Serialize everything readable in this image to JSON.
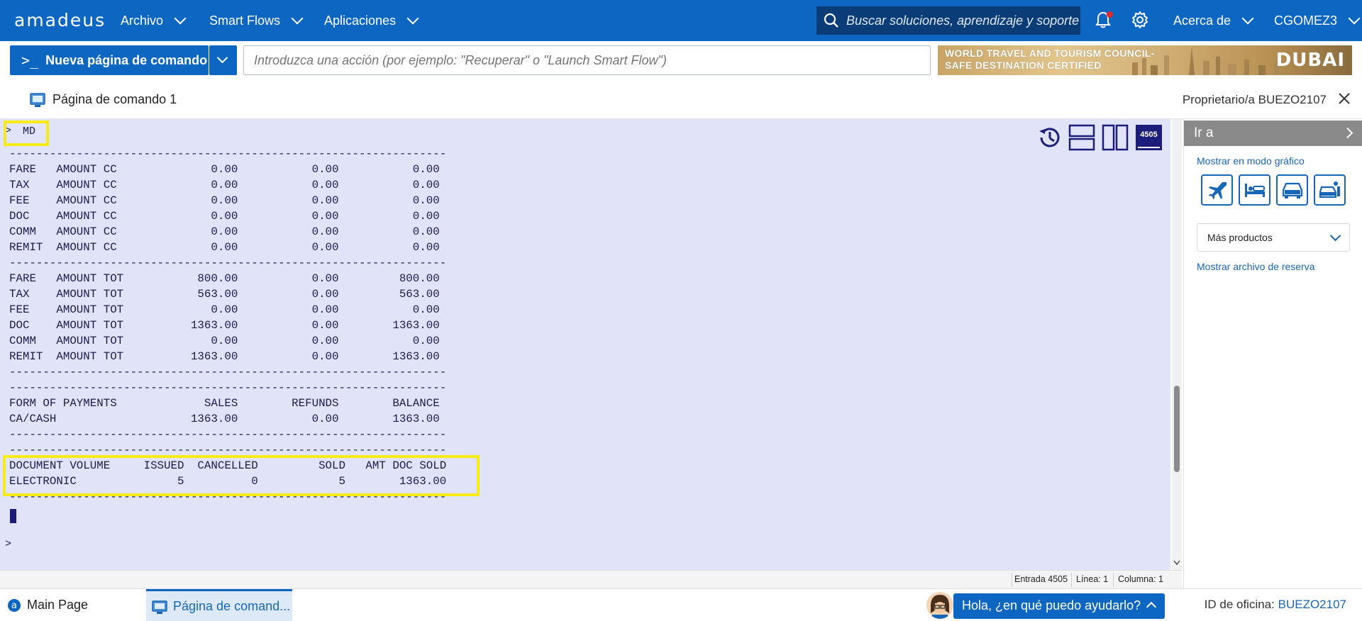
{
  "nav": {
    "logo": "amadeus",
    "menus": [
      {
        "label": "Archivo"
      },
      {
        "label": "Smart Flows"
      },
      {
        "label": "Aplicaciones"
      }
    ],
    "search_placeholder": "Buscar soluciones, aprendizaje y soporte",
    "about": "Acerca de",
    "user": "CGOMEZ3"
  },
  "commandbar": {
    "new_page_label": "Nueva página de comando",
    "action_placeholder": "Introduzca una acción (por ejemplo: \"Recuperar\" o \"Launch Smart Flow\")",
    "banner_line1": "WORLD TRAVEL AND TOURISM COUNCIL-",
    "banner_line2": "SAFE DESTINATION CERTIFIED",
    "banner_brand": "DUBAI"
  },
  "page": {
    "title": "Página de comando 1",
    "owner": "Proprietario/a BUEZO2107"
  },
  "terminal": {
    "prompt": ">",
    "command": "MD",
    "office_badge": "4505",
    "lines": [
      "",
      "-----------------------------------------------------------------",
      "FARE   AMOUNT CC              0.00           0.00           0.00",
      "TAX    AMOUNT CC              0.00           0.00           0.00",
      "FEE    AMOUNT CC              0.00           0.00           0.00",
      "DOC    AMOUNT CC              0.00           0.00           0.00",
      "COMM   AMOUNT CC              0.00           0.00           0.00",
      "REMIT  AMOUNT CC              0.00           0.00           0.00",
      "-----------------------------------------------------------------",
      "FARE   AMOUNT TOT           800.00           0.00         800.00",
      "TAX    AMOUNT TOT           563.00           0.00         563.00",
      "FEE    AMOUNT TOT             0.00           0.00           0.00",
      "DOC    AMOUNT TOT          1363.00           0.00        1363.00",
      "COMM   AMOUNT TOT             0.00           0.00           0.00",
      "REMIT  AMOUNT TOT          1363.00           0.00        1363.00",
      "-----------------------------------------------------------------",
      "-----------------------------------------------------------------",
      "FORM OF PAYMENTS             SALES        REFUNDS        BALANCE",
      "CA/CASH                    1363.00           0.00        1363.00",
      "-----------------------------------------------------------------",
      "-----------------------------------------------------------------",
      "DOCUMENT VOLUME     ISSUED  CANCELLED         SOLD   AMT DOC SOLD",
      "ELECTRONIC               5          0            5        1363.00",
      "-----------------------------------------------------------------"
    ],
    "prompt2": ">",
    "status": {
      "entrada": "Entrada 4505",
      "linea": "Línea: 1",
      "columna": "Columna: 1"
    }
  },
  "rightpanel": {
    "title": "Ir a",
    "graphic_mode": "Mostrar en modo gráfico",
    "products": [
      "plane-icon",
      "hotel-bed-icon",
      "car-icon",
      "car-transfer-icon"
    ],
    "more_products": "Más productos",
    "show_reservation": "Mostrar archivo de reserva"
  },
  "taskbar": {
    "main_page": "Main Page",
    "command_tab": "Página de comand...",
    "chat": "Hola, ¿en qué puedo ayudarlo?",
    "office_label": "ID de oficina:",
    "office_id": "BUEZO2107"
  }
}
